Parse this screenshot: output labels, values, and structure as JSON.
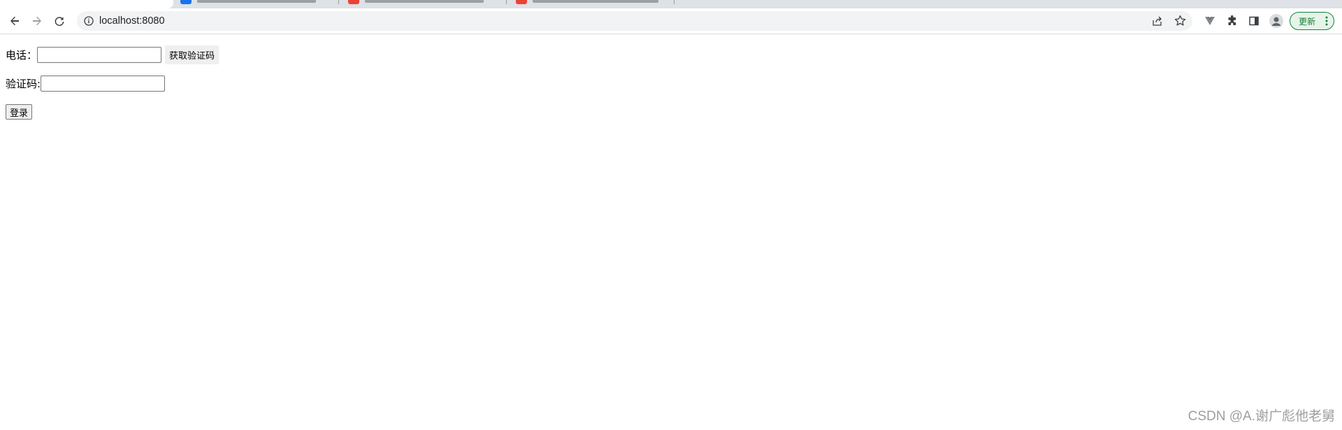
{
  "browser": {
    "url": "localhost:8080",
    "update_label": "更新",
    "colors": {
      "tabstrip": "#dee1e6",
      "omnibox": "#f1f3f4",
      "update_accent": "#188038",
      "tab_favicon_blue": "#1a73e8",
      "tab_favicon_red": "#ea4335"
    },
    "toolbar_icons": [
      "back-arrow-icon",
      "forward-arrow-icon",
      "reload-icon",
      "info-icon",
      "share-icon",
      "star-icon",
      "vue-devtools-icon",
      "extensions-puzzle-icon",
      "side-panel-icon",
      "profile-avatar-icon",
      "more-vert-icon"
    ]
  },
  "form": {
    "phone_label": "电话：",
    "phone_value": "",
    "get_code_label": "获取验证码",
    "code_label": "验证码:",
    "code_value": "",
    "login_label": "登录"
  },
  "watermark": "CSDN @A.谢广彪他老舅"
}
